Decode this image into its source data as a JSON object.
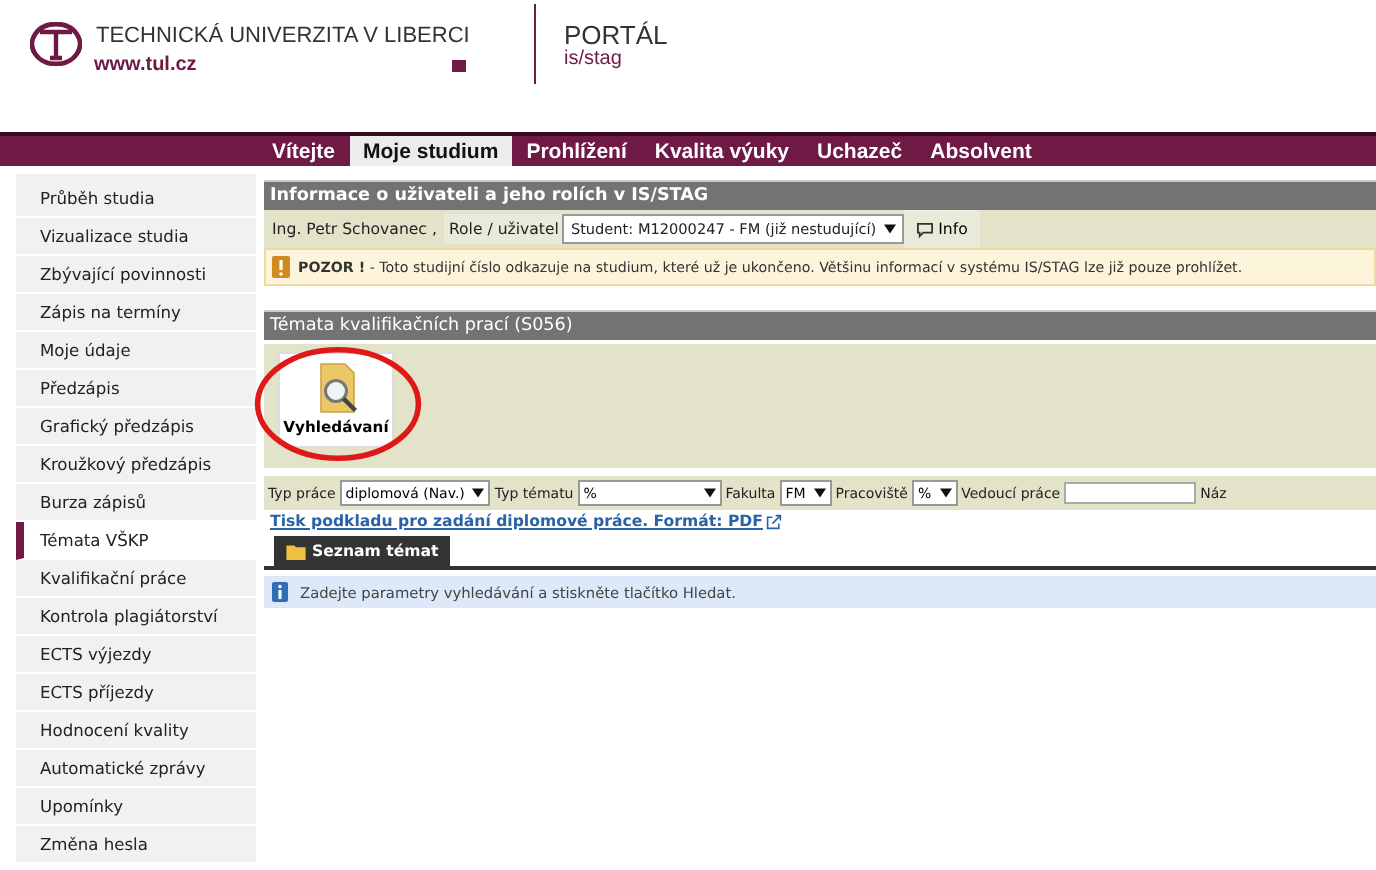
{
  "header": {
    "university": "TECHNICKÁ UNIVERZITA V LIBERCI",
    "website": "www.tul.cz",
    "portal_title": "PORTÁL",
    "portal_subtitle": "is/stag"
  },
  "nav_tabs": [
    {
      "label": "Vítejte",
      "selected": false
    },
    {
      "label": "Moje studium",
      "selected": true
    },
    {
      "label": "Prohlížení",
      "selected": false
    },
    {
      "label": "Kvalita výuky",
      "selected": false
    },
    {
      "label": "Uchazeč",
      "selected": false
    },
    {
      "label": "Absolvent",
      "selected": false
    }
  ],
  "sidebar": {
    "items": [
      {
        "label": "Průběh studia",
        "selected": false
      },
      {
        "label": "Vizualizace studia",
        "selected": false
      },
      {
        "label": "Zbývající povinnosti",
        "selected": false
      },
      {
        "label": "Zápis na termíny",
        "selected": false
      },
      {
        "label": "Moje údaje",
        "selected": false
      },
      {
        "label": "Předzápis",
        "selected": false
      },
      {
        "label": "Grafický předzápis",
        "selected": false
      },
      {
        "label": "Kroužkový předzápis",
        "selected": false
      },
      {
        "label": "Burza zápisů",
        "selected": false
      },
      {
        "label": "Témata VŠKP",
        "selected": true
      },
      {
        "label": "Kvalifikační práce",
        "selected": false
      },
      {
        "label": "Kontrola plagiátorství",
        "selected": false
      },
      {
        "label": "ECTS výjezdy",
        "selected": false
      },
      {
        "label": "ECTS příjezdy",
        "selected": false
      },
      {
        "label": "Hodnocení kvality",
        "selected": false
      },
      {
        "label": "Automatické zprávy",
        "selected": false
      },
      {
        "label": "Upomínky",
        "selected": false
      },
      {
        "label": "Změna hesla",
        "selected": false
      }
    ]
  },
  "user_panel": {
    "title": "Informace o uživateli a jeho rolích v IS/STAG",
    "user_name": "Ing. Petr Schovanec ,",
    "role_label": "Role / uživatel",
    "role_value": "Student: M12000247 - FM (již nestudující)",
    "info_button": "Info",
    "warning": "**POZOR !** - Toto studijní číslo odkazuje na studium, které už je ukončeno. Většinu informací v systému IS/STAG lze již pouze prohlížet."
  },
  "topics_panel": {
    "title": "Témata kvalifikačních prací (S056)",
    "search_button": "Vyhledávaní",
    "highlighted": true,
    "filters": [
      {
        "kind": "select",
        "label": "Typ práce",
        "value": "diplomová (Nav.)"
      },
      {
        "kind": "select",
        "label": "Typ tématu",
        "value": "%"
      },
      {
        "kind": "select",
        "label": "Fakulta",
        "value": "FM"
      },
      {
        "kind": "select",
        "label": "Pracoviště",
        "value": "%"
      },
      {
        "kind": "text",
        "label": "Vedoucí práce"
      },
      {
        "kind": "label",
        "label": "Náz"
      }
    ],
    "print_link": "Tisk podkladu pro zadání diplomové práce. Formát: PDF",
    "list_tab": "Seznam témat",
    "info_message": "Zadejte parametry vyhledávání a stiskněte tlačítko Hledat."
  }
}
